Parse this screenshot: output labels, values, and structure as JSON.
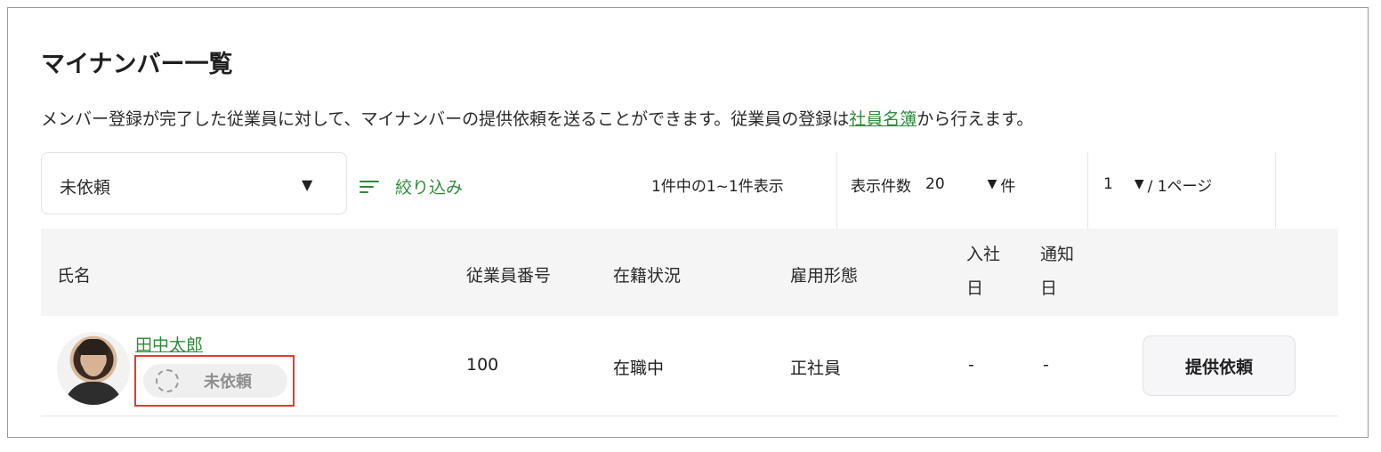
{
  "header": {
    "title": "マイナンバー一覧",
    "description_before": "メンバー登録が完了した従業員に対して、マイナンバーの提供依頼を送ることができます。従業員の登録は",
    "description_link": "社員名簿",
    "description_after": "から行えます。"
  },
  "toolbar": {
    "status_filter_value": "未依頼",
    "filter_label": "絞り込み",
    "count_text": "1件中の1~1件表示",
    "per_page_label": "表示件数",
    "per_page_value": "20",
    "per_page_unit": "件",
    "page_value": "1",
    "page_total": "/ 1ページ"
  },
  "table": {
    "headers": {
      "name": "氏名",
      "employee_no": "従業員番号",
      "status": "在籍状況",
      "employment_type": "雇用形態",
      "join_date": "入社日",
      "notify_date": "通知日"
    },
    "rows": [
      {
        "name": "田中太郎",
        "badge": "未依頼",
        "employee_no": "100",
        "status": "在職中",
        "employment_type": "正社員",
        "join_date": "-",
        "notify_date": "-",
        "action": "提供依頼"
      }
    ]
  },
  "colors": {
    "accent_green": "#2f8a3a",
    "highlight_red": "#e03d32"
  }
}
